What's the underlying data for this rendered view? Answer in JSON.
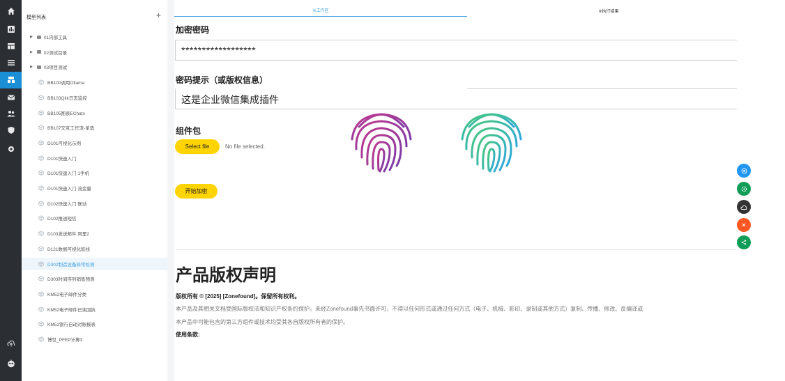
{
  "rail": {
    "icons": [
      "home-icon",
      "chart-icon",
      "table-icon",
      "list-icon",
      "model-icon",
      "mail-icon",
      "users-icon",
      "shield-icon",
      "settings-icon",
      "upload-icon",
      "robot-avatar-icon"
    ]
  },
  "sidebar": {
    "title": "模型列表",
    "add": "+",
    "folders": [
      "01内部工具",
      "02测试目录",
      "03项目测试"
    ],
    "models": [
      "BB100调用Ollama",
      "BB103Qlik日志监控",
      "BB105图表EChats",
      "BB107交互工作流-单选",
      "D101可视化示例",
      "D101快速入门",
      "D101快速入门 1手机",
      "D101快速入门 流变量",
      "D102快速入门 联动",
      "D102推送短信",
      "D103发送邮件 阿里2",
      "D121数据可视化航线",
      "D302制造设备异常检测",
      "D303时间序列销售预测",
      "KM52电子邮件分类",
      "KM52电子邮件已读回执",
      "KM52银行自动对账报表",
      "博世_PFEP计算3"
    ],
    "selected_index": 12
  },
  "tabs": [
    "※工作区",
    "※执行结果"
  ],
  "form": {
    "password_label": "加密密码",
    "password_value": "******************",
    "hint_label": "密码提示（或版权信息）",
    "hint_value": "这是企业微信集成插件",
    "package_label": "组件包",
    "select_file": "Select file",
    "no_file": "No file selected.",
    "start_button": "开始加密"
  },
  "copyright": {
    "title": "产品版权声明",
    "line1": "版权所有 © [2025] [Zonefound]。保留所有权利。",
    "line2": "本产品及其相关文档受国际版权法和知识产权条约保护。未经Zonefound事先书面许可，不得以任何形式或通过任何方式（电子、机械、影印、录制或其他方式）复制、传播、修改、反编译或",
    "line3": "本产品中可能包含的第三方组件或技术均受其各自版权所有者的保护。",
    "line4": "使用条款:"
  },
  "fabs": [
    {
      "icon": "target-icon",
      "color": "#2196f3"
    },
    {
      "icon": "gear-icon",
      "color": "#0f9d58"
    },
    {
      "icon": "cloud-icon",
      "color": "#333333"
    },
    {
      "icon": "close-icon",
      "color": "#ff5722"
    },
    {
      "icon": "share-icon",
      "color": "#0f9d58"
    }
  ],
  "colors": {
    "accent": "#3a9de0",
    "button": "#ffd400",
    "rail_bg": "#2b2f33",
    "fingerprint_left": "#b03a9a",
    "fingerprint_right": "#2bbfd0"
  }
}
